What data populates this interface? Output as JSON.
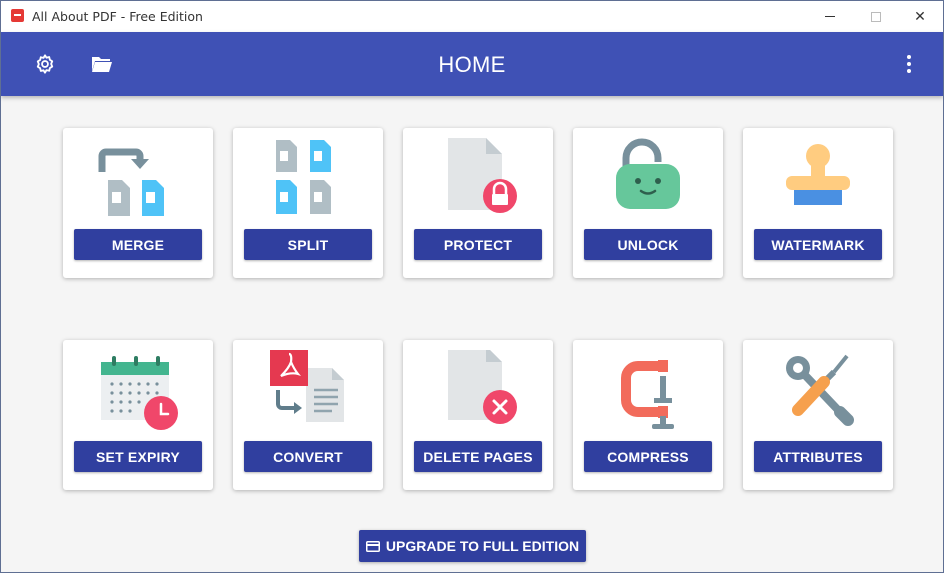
{
  "window": {
    "title": "All About PDF - Free Edition",
    "controls": {
      "minimize": "minimize",
      "maximize": "maximize",
      "close": "✕"
    }
  },
  "appbar": {
    "title": "HOME",
    "settings_icon": "gear-icon",
    "open_icon": "folder-open-icon",
    "more_icon": "more-vertical-icon"
  },
  "tools": [
    {
      "label": "MERGE",
      "icon": "merge-icon"
    },
    {
      "label": "SPLIT",
      "icon": "split-icon"
    },
    {
      "label": "PROTECT",
      "icon": "protect-icon"
    },
    {
      "label": "UNLOCK",
      "icon": "unlock-icon"
    },
    {
      "label": "WATERMARK",
      "icon": "watermark-stamp-icon"
    },
    {
      "label": "SET EXPIRY",
      "icon": "calendar-clock-icon"
    },
    {
      "label": "CONVERT",
      "icon": "convert-pdf-icon"
    },
    {
      "label": "DELETE PAGES",
      "icon": "delete-pages-icon"
    },
    {
      "label": "COMPRESS",
      "icon": "clamp-icon"
    },
    {
      "label": "ATTRIBUTES",
      "icon": "tools-icon"
    }
  ],
  "upgrade": {
    "label": "UPGRADE TO FULL EDITION",
    "icon": "card-icon"
  },
  "colors": {
    "appbar": "#3f51b5",
    "button": "#303f9f",
    "page_gray": "#b0bec5",
    "page_blue": "#4fc3f7",
    "lock_red": "#f0476a",
    "unlock_green": "#66c79b",
    "stamp_yellow": "#ffcc80",
    "stamp_blue": "#4a90e2",
    "calendar_green": "#43b58f",
    "pdf_red": "#e53950",
    "clamp_red": "#f26b5b",
    "handle_orange": "#f6a04d"
  }
}
